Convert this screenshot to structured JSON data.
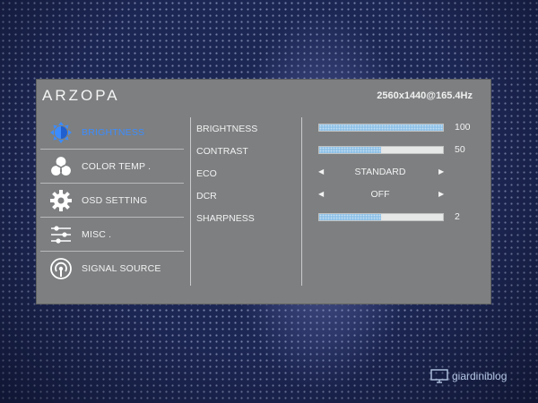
{
  "header": {
    "brand": "ARZOPA",
    "resolution": "2560x1440@165.4Hz"
  },
  "sidebar": {
    "items": [
      {
        "label": "BRIGHTNESS",
        "icon": "brightness-icon",
        "active": true
      },
      {
        "label": "COLOR TEMP .",
        "icon": "color-temp-icon",
        "active": false
      },
      {
        "label": "OSD SETTING",
        "icon": "gear-icon",
        "active": false
      },
      {
        "label": "MISC .",
        "icon": "sliders-icon",
        "active": false
      },
      {
        "label": "SIGNAL SOURCE",
        "icon": "signal-icon",
        "active": false
      }
    ]
  },
  "settings": {
    "items": [
      {
        "label": "BRIGHTNESS",
        "type": "bar",
        "value": "100",
        "level": 100
      },
      {
        "label": "CONTRAST",
        "type": "bar",
        "value": "50",
        "level": 50
      },
      {
        "label": "ECO",
        "type": "select",
        "value": "STANDARD"
      },
      {
        "label": "DCR",
        "type": "select",
        "value": "OFF"
      },
      {
        "label": "SHARPNESS",
        "type": "bar",
        "value": "2",
        "level": 50
      }
    ]
  },
  "watermark": {
    "text": "giardiniblog"
  },
  "colors": {
    "accent": "#3c8cff",
    "panel": "#7d7f80",
    "bar_fill": "#8fc2e8",
    "background": "#1d2754"
  }
}
